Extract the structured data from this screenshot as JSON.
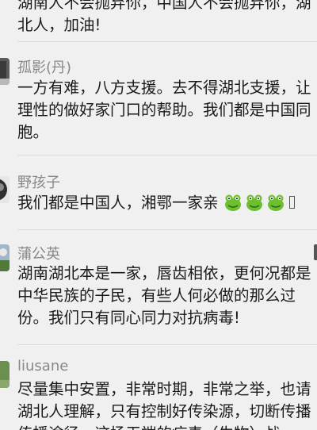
{
  "comments": [
    {
      "id": "c0",
      "body_lines": [
        "湖南人不会抛弃你，中国人不会抛弃你，湖",
        "北人，加油!"
      ]
    },
    {
      "id": "c1",
      "author": "孤影(丹)",
      "body_lines": [
        "一方有难，八方支援。去不得湖北支援，让",
        "理性的做好家门口的帮助。我们都是中国同",
        "胞。"
      ]
    },
    {
      "id": "c2",
      "author": "野孩子",
      "body_lines": [
        "我们都是中国人，湘鄂一家亲"
      ],
      "emoji": [
        "frog-emoji",
        "frog-emoji",
        "frog-emoji"
      ]
    },
    {
      "id": "c3",
      "author": "蒲公英",
      "body_lines": [
        "湖南湖北本是一家，唇齿相依，更何况都是",
        "中华民族的子民，有些人何必做的那么过",
        "份。我们只有同心同力对抗病毒!"
      ]
    },
    {
      "id": "c4",
      "author": "liusane",
      "body_lines": [
        "尽量集中安置，非常时期，非常之举，也请",
        "湖北人理解，只有控制好传染源，切断传播",
        "传播途径，这场无端的病毒（生物）战"
      ]
    }
  ],
  "colors": {
    "background": "#f0f0f0",
    "author": "#888888",
    "text": "#1a1a1a",
    "divider": "#dcdcdc"
  }
}
